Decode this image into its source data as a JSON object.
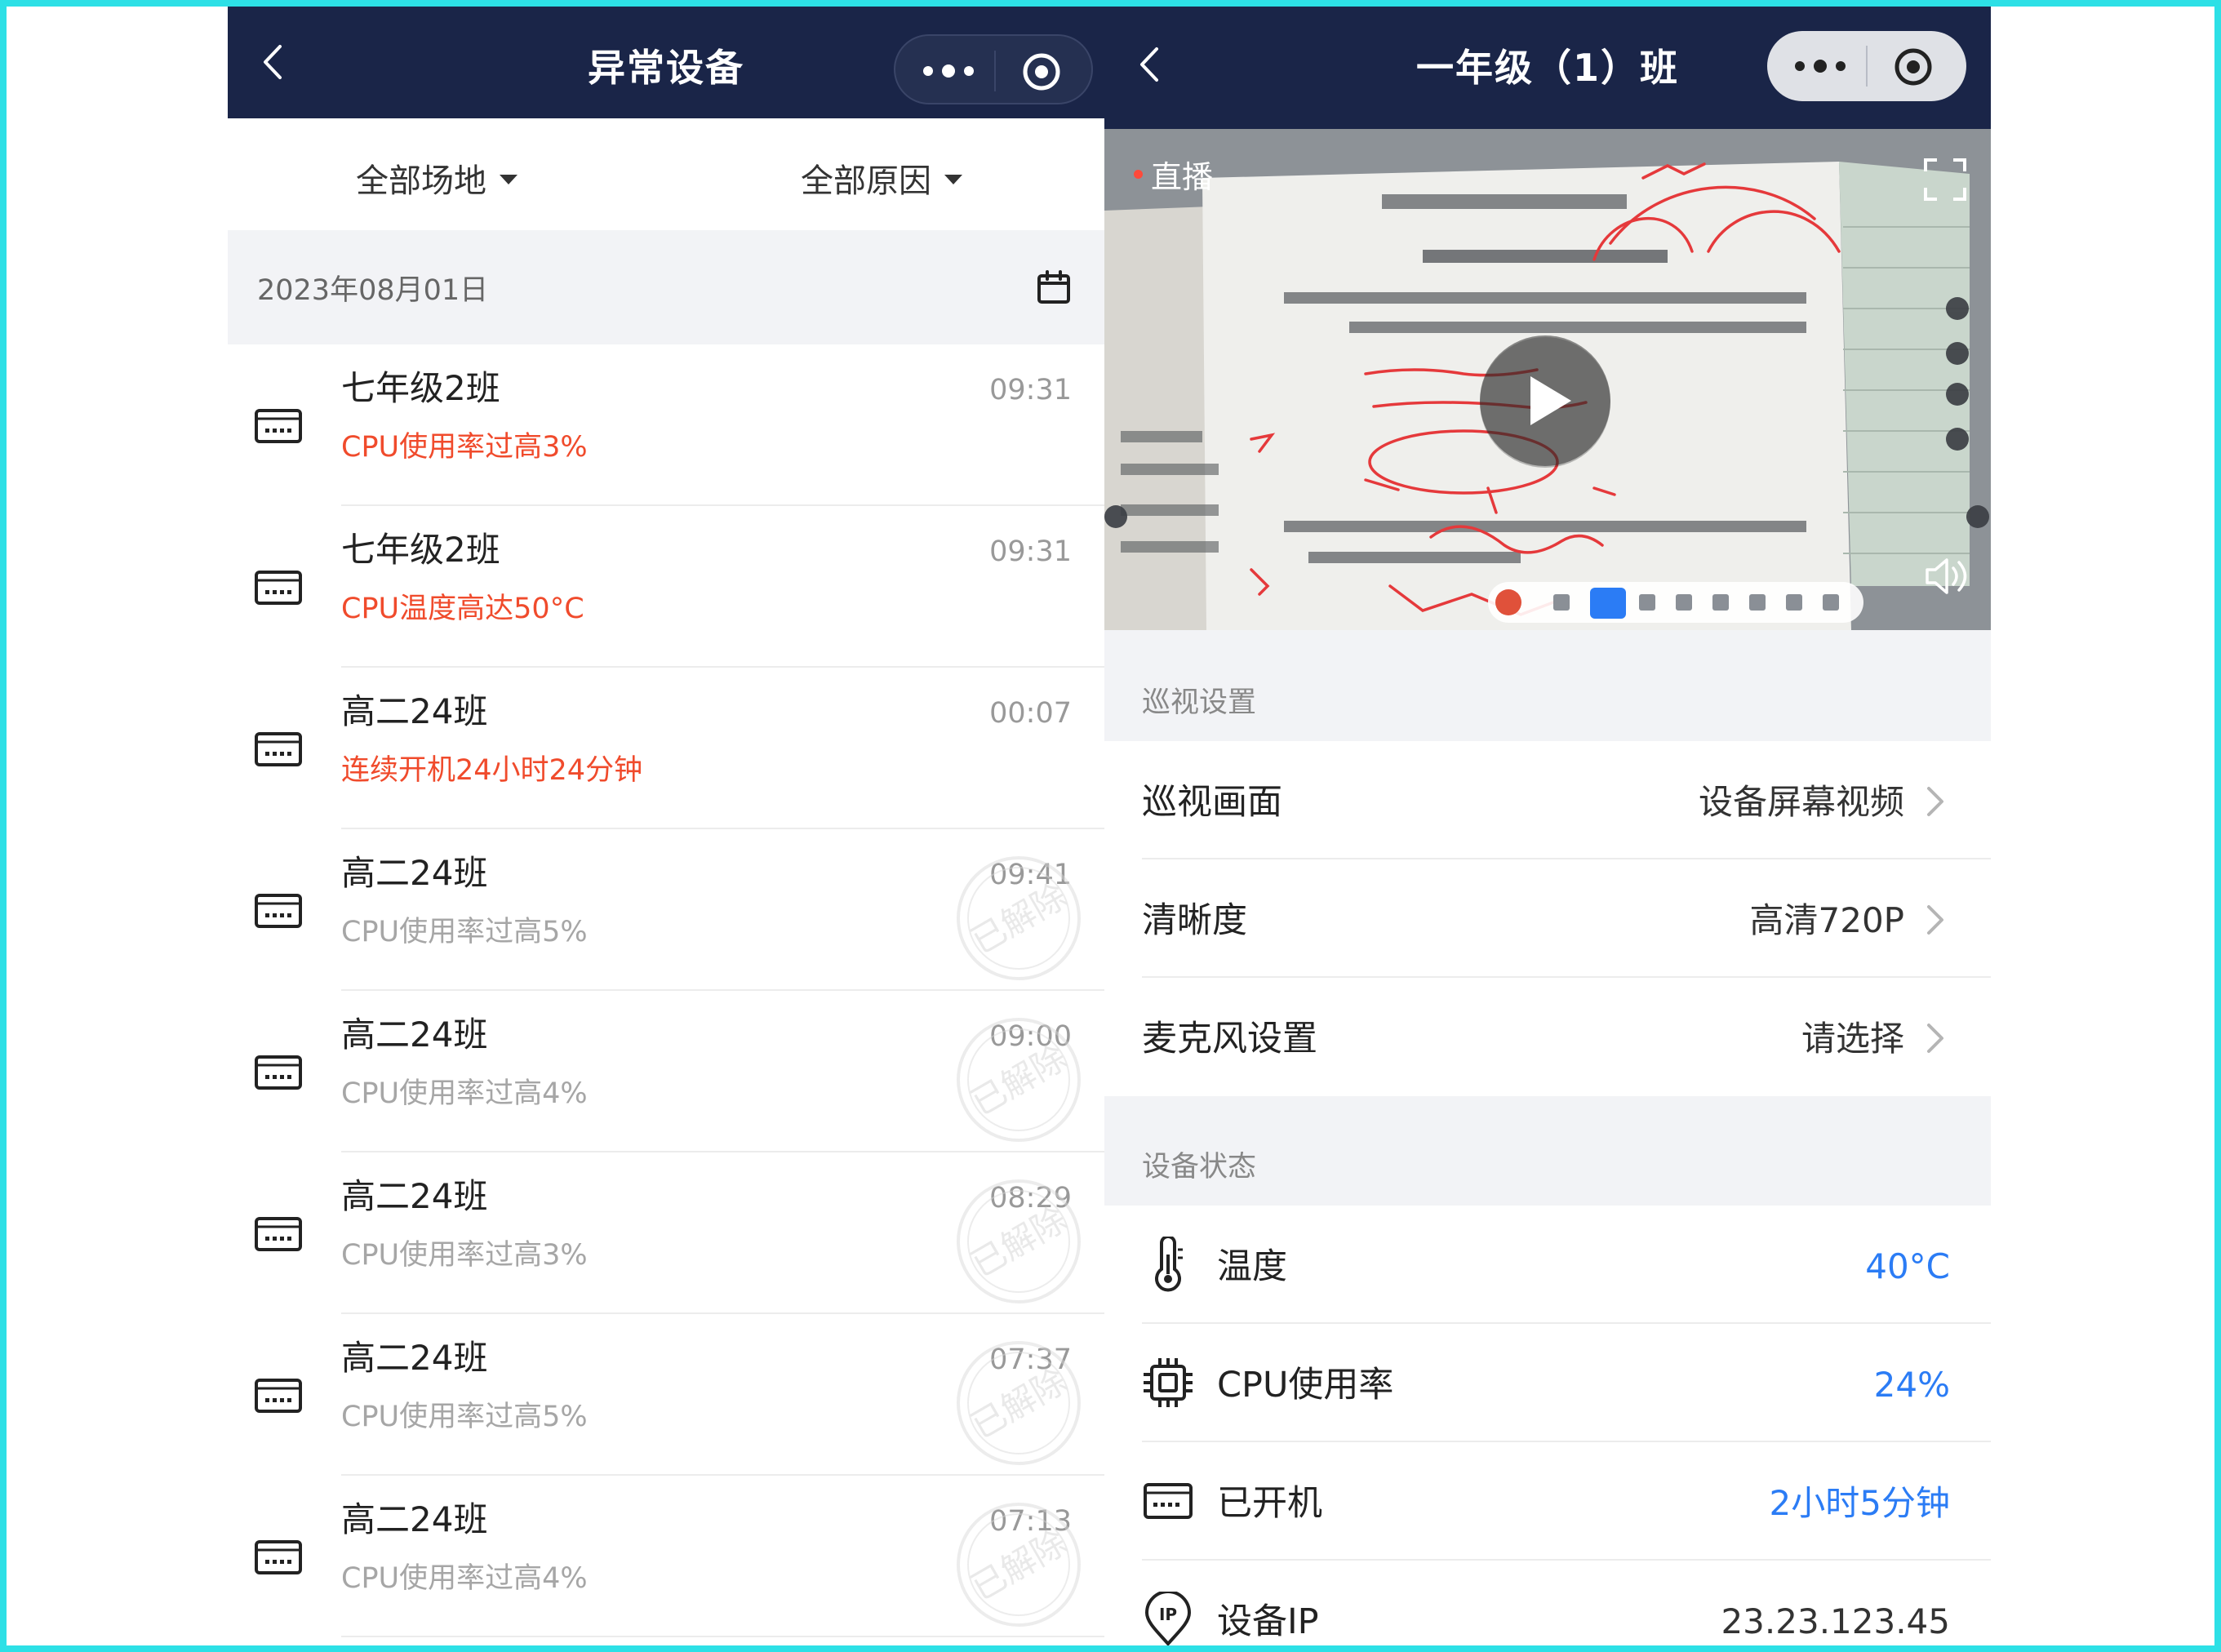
{
  "left": {
    "nav_title": "异常设备",
    "filters": {
      "place": "全部场地",
      "reason": "全部原因"
    },
    "date": "2023年08月01日",
    "items": [
      {
        "title": "七年级2班",
        "time": "09:31",
        "desc": "CPU使用率过高3%",
        "state": "active"
      },
      {
        "title": "七年级2班",
        "time": "09:31",
        "desc": "CPU温度高达50°C",
        "state": "active"
      },
      {
        "title": "高二24班",
        "time": "00:07",
        "desc": "连续开机24小时24分钟",
        "state": "active"
      },
      {
        "title": "高二24班",
        "time": "09:41",
        "desc": "CPU使用率过高5%",
        "state": "resolved",
        "stamp": "已解除"
      },
      {
        "title": "高二24班",
        "time": "09:00",
        "desc": "CPU使用率过高4%",
        "state": "resolved",
        "stamp": "已解除"
      },
      {
        "title": "高二24班",
        "time": "08:29",
        "desc": "CPU使用率过高3%",
        "state": "resolved",
        "stamp": "已解除"
      },
      {
        "title": "高二24班",
        "time": "07:37",
        "desc": "CPU使用率过高5%",
        "state": "resolved",
        "stamp": "已解除"
      },
      {
        "title": "高二24班",
        "time": "07:13",
        "desc": "CPU使用率过高4%",
        "state": "resolved",
        "stamp": "已解除"
      }
    ]
  },
  "right": {
    "nav_title": "一年级（1）班",
    "live_label": "直播",
    "patrol_section": "巡视设置",
    "patrol_rows": [
      {
        "label": "巡视画面",
        "value": "设备屏幕视频"
      },
      {
        "label": "清晰度",
        "value": "高清720P"
      },
      {
        "label": "麦克风设置",
        "value": "请选择"
      }
    ],
    "status_section": "设备状态",
    "status_rows": [
      {
        "icon": "thermometer-icon",
        "label": "温度",
        "value": "40°C"
      },
      {
        "icon": "cpu-chip-icon",
        "label": "CPU使用率",
        "value": "24%"
      },
      {
        "icon": "device-icon",
        "label": "已开机",
        "value": "2小时5分钟"
      },
      {
        "icon": "ip-location-icon",
        "label": "设备IP",
        "value": "23.23.123.45"
      }
    ]
  },
  "colors": {
    "nav_bg": "#1a2548",
    "alert_red": "#f04b2c",
    "value_blue": "#2b7cf5",
    "frame": "#2de0e6"
  }
}
